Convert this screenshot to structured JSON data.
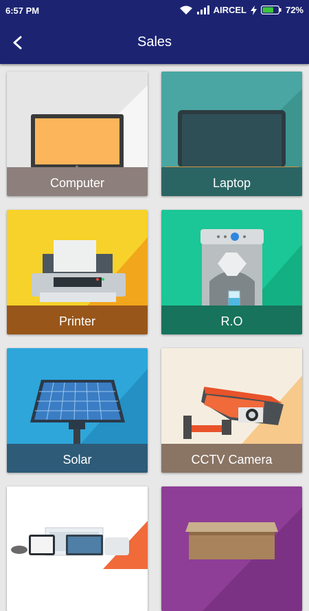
{
  "status_bar": {
    "time": "6:57 PM",
    "carrier": "AIRCEL",
    "battery": "72%",
    "battery_level": 0.72
  },
  "app_bar": {
    "title": "Sales",
    "back_icon": "back-arrow-icon"
  },
  "tiles": [
    {
      "label": "Computer",
      "icon": "computer-icon",
      "bg": "#e6e6e6"
    },
    {
      "label": "Laptop",
      "icon": "laptop-icon",
      "bg": "#4aa6a2"
    },
    {
      "label": "Printer",
      "icon": "printer-icon",
      "bg": "#f6d22a"
    },
    {
      "label": "R.O",
      "icon": "water-purifier-icon",
      "bg": "#1bc797"
    },
    {
      "label": "Solar",
      "icon": "solar-panel-icon",
      "bg": "#2ea6da"
    },
    {
      "label": "CCTV Camera",
      "icon": "cctv-camera-icon",
      "bg": "#f5ede0"
    },
    {
      "label": "",
      "icon": "devices-icon",
      "bg": "#ffffff"
    },
    {
      "label": "",
      "icon": "box-icon",
      "bg": "#8e3e96"
    }
  ]
}
